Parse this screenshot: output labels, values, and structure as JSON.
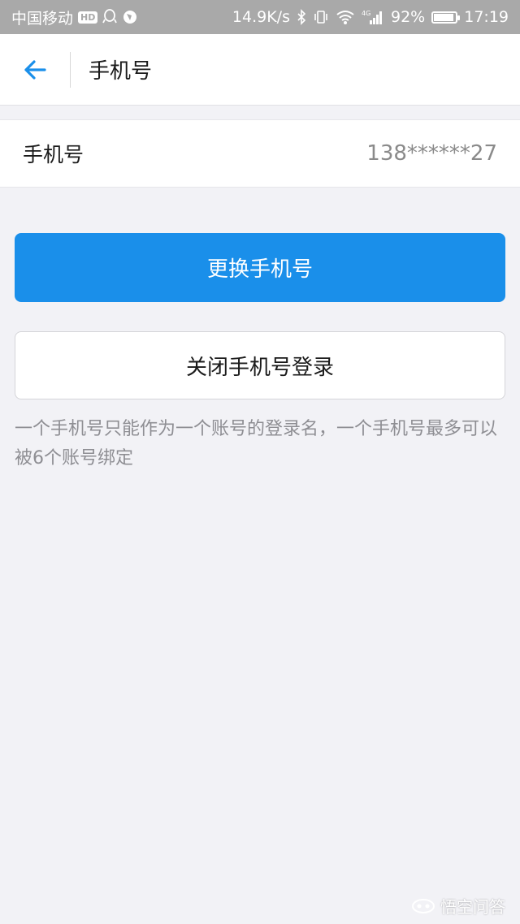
{
  "status_bar": {
    "carrier": "中国移动",
    "hd_badge": "HD",
    "network_speed": "14.9K/s",
    "network_type": "4G",
    "battery_percent": "92%",
    "battery_level": 0.92,
    "time": "17:19"
  },
  "nav": {
    "back_icon": "arrow-left-icon",
    "title": "手机号"
  },
  "phone_row": {
    "label": "手机号",
    "value": "138******27"
  },
  "buttons": {
    "change_phone": "更换手机号",
    "disable_phone_login": "关闭手机号登录"
  },
  "hint": "一个手机号只能作为一个账号的登录名，一个手机号最多可以被6个账号绑定",
  "watermark": {
    "text": "悟空问答"
  },
  "colors": {
    "accent": "#1a8fea",
    "background": "#f2f2f6",
    "status_bar": "#a9a9a9",
    "hint_text": "#8e8e93"
  }
}
